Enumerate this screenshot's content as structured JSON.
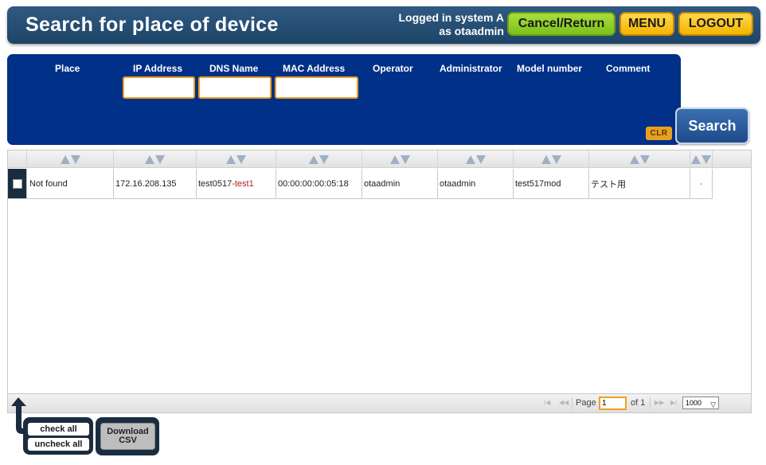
{
  "header": {
    "title": "Search for place of device",
    "login_line1": "Logged in system A",
    "login_line2": "as otaadmin",
    "cancel_label": "Cancel/Return",
    "menu_label": "MENU",
    "logout_label": "LOGOUT"
  },
  "search": {
    "columns": [
      "Place",
      "IP Address",
      "DNS Name",
      "MAC Address",
      "Operator",
      "Administrator",
      "Model number",
      "Comment"
    ],
    "ip_value": "",
    "dns_value": "",
    "mac_value": "",
    "clr_label": "CLR",
    "search_label": "Search"
  },
  "table": {
    "rows": [
      {
        "place": "Not found",
        "ip": "172.16.208.135",
        "dns_main": "test0517",
        "dns_suffix": "-test1",
        "mac": "00:00:00:00:05:18",
        "operator": "otaadmin",
        "administrator": "otaadmin",
        "model": "test517mod",
        "comment": "テスト用",
        "extra": "-"
      }
    ]
  },
  "pager": {
    "page_label": "Page",
    "page_value": "1",
    "of_label": "of 1",
    "page_size": "1000"
  },
  "bottom": {
    "check_all": "check all",
    "uncheck_all": "uncheck all",
    "download_line1": "Download",
    "download_line2": "CSV"
  }
}
